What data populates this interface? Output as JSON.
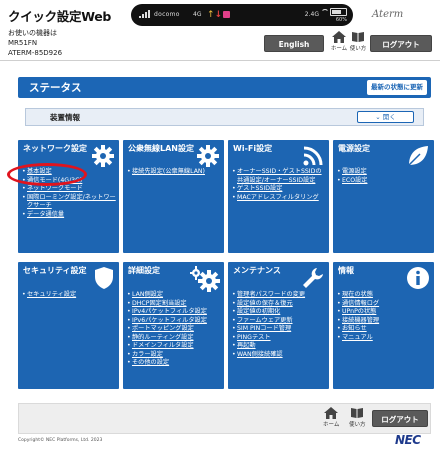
{
  "header": {
    "title": "クイック設定Web",
    "device_label": "お使いの機器は",
    "model": "MR51FN",
    "device_name": "ATERM-85D926",
    "brand_logo": "Aterm",
    "english_button": "English",
    "home_label": "ホーム",
    "help_label": "使い方",
    "logout_button": "ログアウト"
  },
  "device_bar": {
    "operator": "docomo",
    "network": "4G",
    "band": "2.4G",
    "battery": "60%"
  },
  "status": {
    "title": "ステータス",
    "refresh_button": "最新の状態に更新",
    "device_info_label": "装置情報",
    "open_button": "開く"
  },
  "tiles": {
    "network": {
      "title": "ネットワーク設定",
      "items": [
        "基本設定",
        "通信モード(4G/3G)",
        "ネットワークモード",
        "国際ローミング設定/ネットワークサーチ",
        "データ通信量"
      ]
    },
    "public_wlan": {
      "title": "公衆無線LAN設定",
      "items": [
        "接続先設定(公衆無線LAN)"
      ]
    },
    "wifi": {
      "title": "Wi-Fi設定",
      "items": [
        "オーナーSSID・ゲストSSIDの共通設定/オーナーSSID設定",
        "ゲストSSID設定",
        "MACアドレスフィルタリング"
      ]
    },
    "power": {
      "title": "電源設定",
      "items": [
        "電源設定",
        "ECO設定"
      ]
    },
    "security": {
      "title": "セキュリティ設定",
      "items": [
        "セキュリティ設定"
      ]
    },
    "detail": {
      "title": "詳細設定",
      "items": [
        "LAN側設定",
        "DHCP固定割当設定",
        "IPv4パケットフィルタ設定",
        "IPv6パケットフィルタ設定",
        "ポートマッピング設定",
        "静的ルーティング設定",
        "ドメインフィルタ設定",
        "カラー設定",
        "その他の設定"
      ]
    },
    "maintenance": {
      "title": "メンテナンス",
      "items": [
        "管理者パスワードの変更",
        "設定値の保存＆復元",
        "設定値の初期化",
        "ファームウェア更新",
        "SIM PINコード管理",
        "PINGテスト",
        "再起動",
        "WAN側接続確認"
      ]
    },
    "info": {
      "title": "情報",
      "items": [
        "現在の状態",
        "通信情報ログ",
        "UPnPの状態",
        "接続機器管理",
        "お知らせ",
        "マニュアル"
      ]
    }
  },
  "footer": {
    "home_label": "ホーム",
    "help_label": "使い方",
    "logout_button": "ログアウト",
    "copyright": "Copyright© NEC Platforms, Ltd. 2023",
    "logo": "NEC"
  },
  "colors": {
    "tile_blue": "#1d65b2",
    "header_bar_blue": "#1c66b5",
    "highlight_red": "#e0141e",
    "button_gray": "#5a5a5a"
  },
  "icons": [
    "gear-icon",
    "wifi-icon",
    "leaf-icon",
    "gears-icon",
    "wrench-icon",
    "info-icon",
    "home-icon",
    "book-icon"
  ]
}
